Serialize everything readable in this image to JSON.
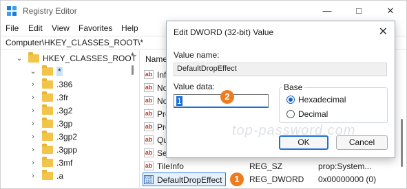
{
  "app": {
    "title": "Registry Editor",
    "min": "—",
    "max": "□",
    "close": "✕"
  },
  "menu": [
    "File",
    "Edit",
    "View",
    "Favorites",
    "Help"
  ],
  "address": "Computer\\HKEY_CLASSES_ROOT\\*",
  "tree": {
    "root": "HKEY_CLASSES_ROOT",
    "items": [
      "*",
      ".386",
      ".3fr",
      ".3g2",
      ".3gp",
      ".3gp2",
      ".3gpp",
      ".3mf",
      ".a"
    ]
  },
  "list": {
    "header_name": "Name",
    "rows": [
      {
        "name": "Inf"
      },
      {
        "name": "No"
      },
      {
        "name": "No"
      },
      {
        "name": "Pre"
      },
      {
        "name": "Pre"
      },
      {
        "name": "Qu"
      },
      {
        "name": "Set"
      },
      {
        "name": "TileInfo",
        "type": "REG_SZ",
        "data": "prop:System..."
      },
      {
        "name": "DefaultDropEffect",
        "type": "REG_DWORD",
        "data": "0x00000000 (0)"
      }
    ]
  },
  "markers": {
    "one": "1",
    "two": "2"
  },
  "dialog": {
    "title": "Edit DWORD (32-bit) Value",
    "close": "✕",
    "value_name_label": "Value name:",
    "value_name": "DefaultDropEffect",
    "value_data_label": "Value data:",
    "value_data": "1",
    "base_label": "Base",
    "hex_label": "Hexadecimal",
    "dec_label": "Decimal",
    "ok": "OK",
    "cancel": "Cancel",
    "watermark": "top-password.com"
  },
  "colors": {
    "accent": "#1e6fd9",
    "marker": "#ee7c1f",
    "folder": "#f2c449"
  }
}
